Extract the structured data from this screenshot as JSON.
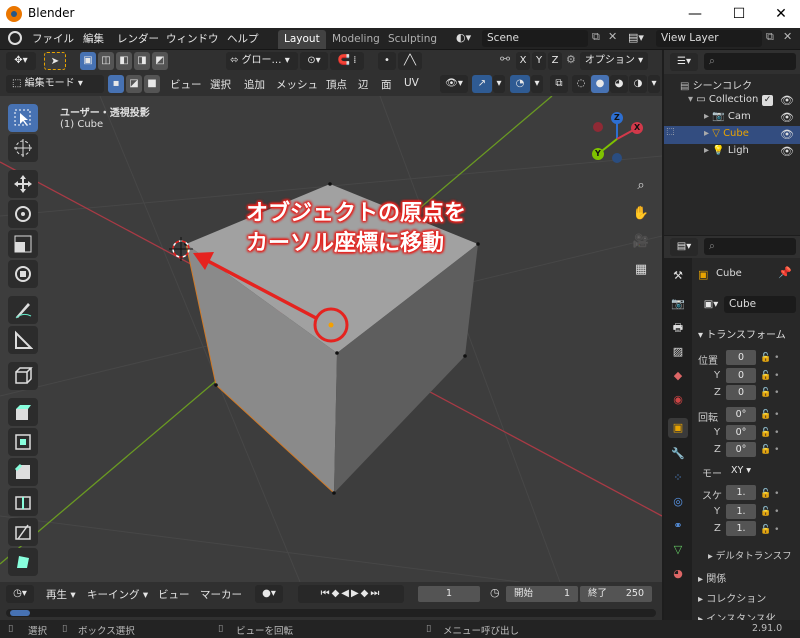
{
  "window": {
    "title": "Blender",
    "minimize": "—",
    "maximize": "☐",
    "close": "✕"
  },
  "menu": {
    "items": [
      "ファイル",
      "編集",
      "レンダー",
      "ウィンドウ",
      "ヘルプ"
    ]
  },
  "workspaces": {
    "tabs": [
      "Layout",
      "Modeling",
      "Sculpting"
    ],
    "active": "Layout"
  },
  "scene": {
    "name": "Scene"
  },
  "view_layer": {
    "name": "View Layer"
  },
  "tool_header": {
    "orientation": "グロー…",
    "options": "オプション",
    "axes": [
      "X",
      "Y",
      "Z"
    ]
  },
  "view_header": {
    "mode": "編集モード",
    "menus": [
      "ビュー",
      "選択",
      "追加",
      "メッシュ",
      "頂点",
      "辺",
      "面",
      "UV"
    ]
  },
  "viewport": {
    "view_name": "ユーザー・透視投影",
    "object_label": "(1) Cube",
    "gizmo_axes": [
      "X",
      "Y",
      "Z"
    ]
  },
  "annotation": {
    "line1": "オブジェクトの原点を",
    "line2": "カーソル座標に移動"
  },
  "outliner": {
    "items": [
      {
        "label": "シーンコレク",
        "icon": "scene-collection-icon"
      },
      {
        "label": "Collection",
        "icon": "collection-icon"
      },
      {
        "label": "Cam",
        "icon": "camera-icon"
      },
      {
        "label": "Cube",
        "icon": "mesh-icon"
      },
      {
        "label": "Ligh",
        "icon": "light-icon"
      }
    ]
  },
  "properties": {
    "object_name": "Cube",
    "mesh_name": "Cube",
    "transform_header": "トランスフォーム",
    "location_label": "位置",
    "rotation_label": "回転",
    "mode_label": "モー",
    "mode_value": "XY",
    "scale_label": "スケ",
    "axes": [
      "X",
      "Y",
      "Z"
    ],
    "location": [
      "0",
      "0",
      "0"
    ],
    "rotation": [
      "0°",
      "0°",
      "0°"
    ],
    "scale": [
      "1.",
      "1.",
      "1."
    ],
    "delta_transform": "デルタトランスフ",
    "relations": "関係",
    "collections": "コレクション",
    "instancing": "インスタンス化"
  },
  "timeline": {
    "menus": [
      "再生",
      "キーイング",
      "ビュー",
      "マーカー"
    ],
    "current_frame": "1",
    "start_label": "開始",
    "start": "1",
    "end_label": "終了",
    "end": "250"
  },
  "status": {
    "select": "選択",
    "box_select": "ボックス選択",
    "rotate_view": "ビューを回転",
    "call_menu": "メニュー呼び出し",
    "version": "2.91.0"
  },
  "colors": {
    "accent": "#4772b3",
    "annotation_red": "#e5231f",
    "x_axis": "#ff3352",
    "y_axis": "#8bdc00",
    "z_axis": "#2890ff"
  }
}
